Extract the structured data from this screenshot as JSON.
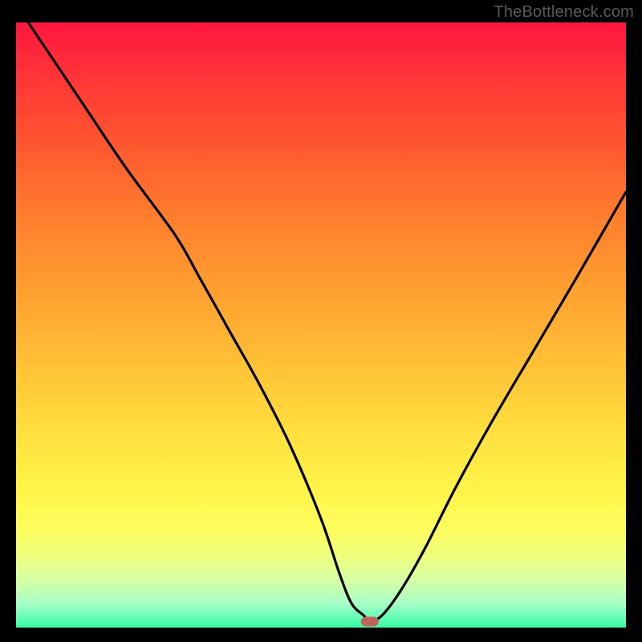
{
  "watermark": "TheBottleneck.com",
  "chart_data": {
    "type": "line",
    "title": "",
    "xlabel": "",
    "ylabel": "",
    "xlim": [
      0,
      100
    ],
    "ylim": [
      0,
      100
    ],
    "grid": false,
    "legend": false,
    "background": "rainbow-vertical-gradient-red-to-green",
    "series": [
      {
        "name": "bottleneck-curve",
        "x": [
          2,
          10,
          18,
          26,
          30,
          35,
          40,
          45,
          50,
          53,
          55,
          57,
          58,
          60,
          63,
          67,
          72,
          78,
          85,
          92,
          100
        ],
        "y": [
          100,
          88,
          76,
          65,
          58,
          49,
          40,
          30,
          18,
          9,
          4,
          2,
          1,
          2,
          6,
          13,
          23,
          34,
          46,
          58,
          72
        ]
      }
    ],
    "min_point": {
      "x": 58,
      "y": 1
    },
    "marker": {
      "x": 58,
      "y": 1,
      "color": "#c4635e",
      "shape": "rounded-rect"
    }
  },
  "colors": {
    "page_bg": "#000000",
    "watermark": "#5a5a5a",
    "curve": "#000000",
    "marker": "#c4635e"
  }
}
